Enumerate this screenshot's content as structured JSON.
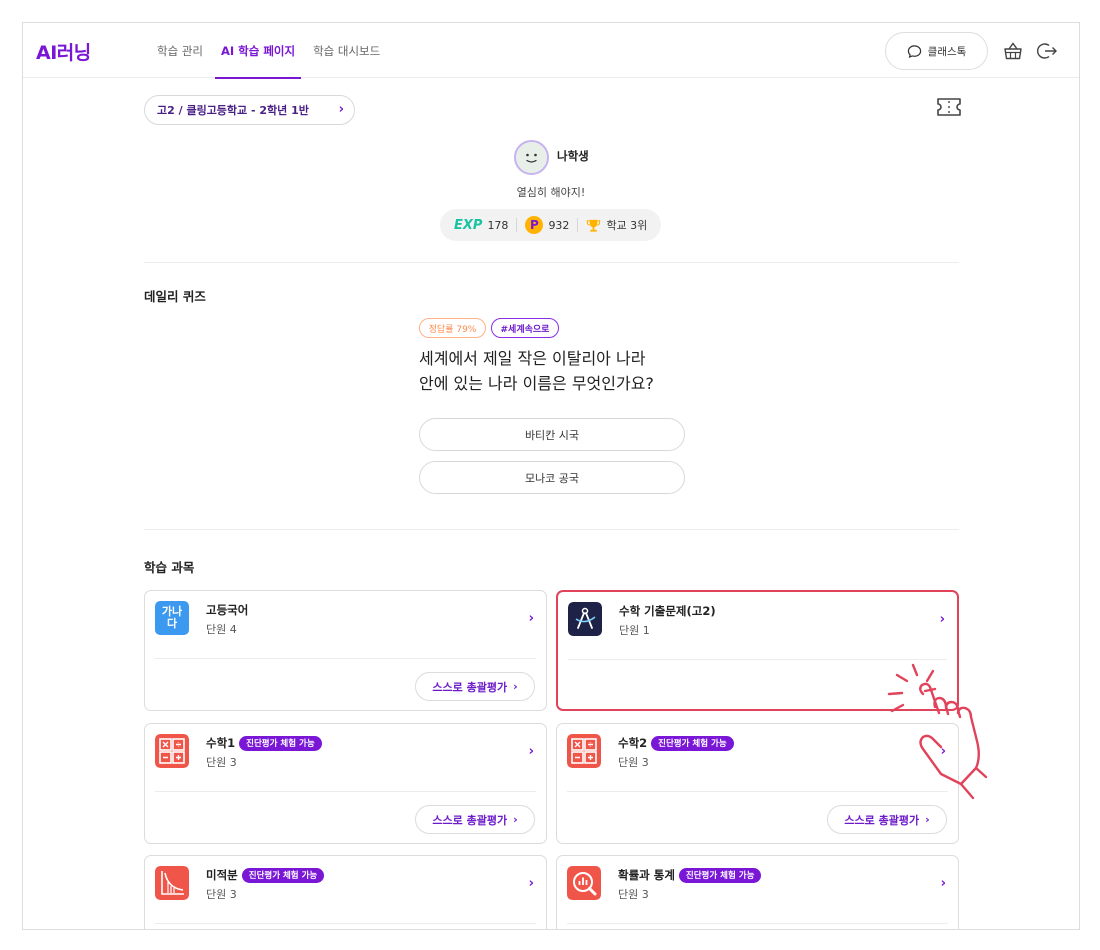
{
  "app": {
    "logo": "AI러닝"
  },
  "nav": {
    "items": [
      {
        "label": "학습 관리",
        "active": false
      },
      {
        "label": "AI 학습 페이지",
        "active": true
      },
      {
        "label": "학습 대시보드",
        "active": false
      }
    ]
  },
  "header": {
    "classtalk_label": "클래스톡",
    "icons": [
      "chat-bubble-icon",
      "shopping-basket-icon",
      "logout-icon"
    ]
  },
  "class_selector": {
    "label": "고2 / 클링고등학교 - 2학년 1반"
  },
  "profile": {
    "name": "나학생",
    "status": "열심히 해야지!",
    "exp_label": "EXP",
    "exp": "178",
    "points": "932",
    "point_icon_letter": "P",
    "rank": "학교 3위"
  },
  "quiz": {
    "title": "데일리 퀴즈",
    "rate_tag": "정답률 79%",
    "topic_tag": "#세계속으로",
    "question_lines": [
      "세계에서 제일 작은 이탈리아 나라",
      "안에 있는 나라 이름은 무엇인가요?"
    ],
    "answers": [
      "바티칸 시국",
      "모나코 공국"
    ]
  },
  "subjects": {
    "title": "학습 과목",
    "self_eval_label": "스스로 총괄평가",
    "badge_label": "진단평가 체험 가능",
    "cards": [
      {
        "title": "고등국어",
        "unit": "단원 4",
        "icon": "korean-text-icon",
        "icon_text": "가나다",
        "badge": false,
        "self_eval": true,
        "highlight": false,
        "color": "#3b9af0"
      },
      {
        "title": "수학 기출문제(고2)",
        "unit": "단원 1",
        "icon": "compass-icon",
        "badge": false,
        "self_eval": false,
        "highlight": true,
        "color": "#1e2247"
      },
      {
        "title": "수학1",
        "unit": "단원 3",
        "icon": "calculator-icon",
        "badge": true,
        "self_eval": true,
        "highlight": false,
        "color": "#f0554a"
      },
      {
        "title": "수학2",
        "unit": "단원 3",
        "icon": "calculator-icon",
        "badge": true,
        "self_eval": true,
        "highlight": false,
        "color": "#f0554a"
      },
      {
        "title": "미적분",
        "unit": "단원 3",
        "icon": "graph-curve-icon",
        "badge": true,
        "self_eval": false,
        "highlight": false,
        "color": "#f0554a"
      },
      {
        "title": "확률과 통계",
        "unit": "단원 3",
        "icon": "magnifier-chart-icon",
        "badge": true,
        "self_eval": false,
        "highlight": false,
        "color": "#f0554a"
      }
    ]
  },
  "colors": {
    "brand": "#7a16d6",
    "highlight": "#e0435a",
    "exp": "#19c3a2",
    "point": "#ffb300"
  }
}
